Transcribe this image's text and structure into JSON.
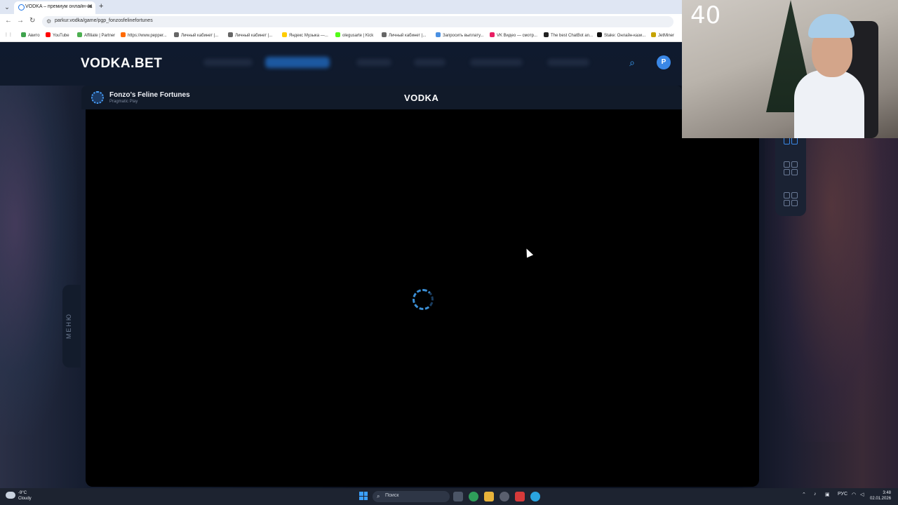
{
  "browser": {
    "tab_title": "VODKA – премиум онлайн-ка",
    "url": "parkur.vodka/game/pgp_fonzosfelinefortunes",
    "bookmarks": [
      {
        "label": "Авито",
        "color": "#3fa34d"
      },
      {
        "label": "YouTube",
        "color": "#ff0000"
      },
      {
        "label": "Affiliate | Partner",
        "color": "#4caf50"
      },
      {
        "label": "https://www.pepper...",
        "color": "#ff6a00"
      },
      {
        "label": "Личный кабинет |...",
        "color": "#666666"
      },
      {
        "label": "Личный кабинет |...",
        "color": "#666666"
      },
      {
        "label": "Яндекс Музыка —...",
        "color": "#ffcc00"
      },
      {
        "label": "olegusarte | Kick",
        "color": "#53fc18"
      },
      {
        "label": "Личный кабинет |...",
        "color": "#666666"
      },
      {
        "label": "Запросить выплату...",
        "color": "#4a90e2"
      },
      {
        "label": "VK Видео — смотр...",
        "color": "#e91e63"
      },
      {
        "label": "The best ChatBot an...",
        "color": "#222222"
      },
      {
        "label": "Stake: Онлайн-кази...",
        "color": "#111111"
      },
      {
        "label": "JetMiner",
        "color": "#c6a300"
      }
    ]
  },
  "site": {
    "logo": "VODKA.BET",
    "avatar_letter": "P",
    "game": {
      "title": "Fonzo’s Feline Fortunes",
      "provider": "Pragmatic Play",
      "frame_logo": "VODKA"
    },
    "menu_tab": "МЕНЮ"
  },
  "overlay": {
    "counter": "40"
  },
  "taskbar": {
    "weather_temp": "-9°C",
    "weather_desc": "Cloudy",
    "search_placeholder": "Поиск",
    "language": "РУС",
    "time": "3:48",
    "date": "02.01.2026"
  }
}
